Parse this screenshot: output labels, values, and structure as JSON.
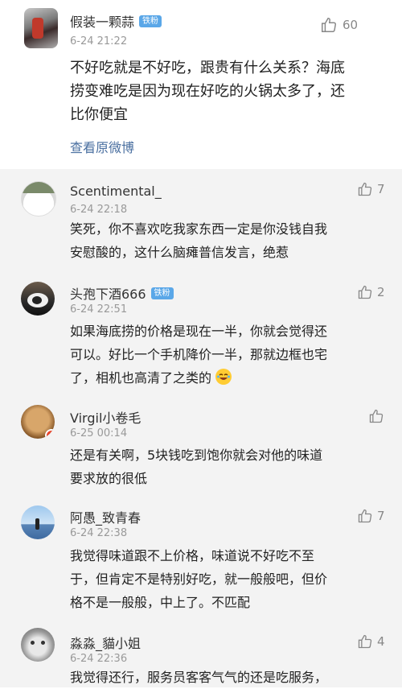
{
  "main_comment": {
    "username": "假装一颗蒜",
    "badge": "铁粉",
    "time": "6-24 21:22",
    "like_count": "60",
    "lines": [
      "不好吃就是不好吃，跟贵有什么关系？海底",
      "捞变难吃是因为现在好吃的火锅太多了，还",
      "比你便宜"
    ],
    "view_original": "查看原微博"
  },
  "replies": [
    {
      "username": "Scentimental_",
      "badge": "",
      "time": "6-24 22:18",
      "like_count": "7",
      "lines": [
        "笑死，你不喜欢吃我家东西一定是你没钱自我",
        "安慰酸的，这什么脑瘫普信发言，绝惹"
      ]
    },
    {
      "username": "头孢下酒666",
      "badge": "铁粉",
      "time": "6-24 22:51",
      "like_count": "2",
      "lines": [
        "如果海底捞的价格是现在一半，你就会觉得还",
        "可以。好比一个手机降价一半，那就边框也宅",
        "了，相机也高清了之类的"
      ]
    },
    {
      "username": "Virgil小卷毛",
      "badge": "",
      "time": "6-25 00:14",
      "like_count": "",
      "lines": [
        "还是有关啊，5块钱吃到饱你就会对他的味道",
        "要求放的很低"
      ]
    },
    {
      "username": "阿愚_致青春",
      "badge": "",
      "time": "6-24 22:38",
      "like_count": "7",
      "lines": [
        "我觉得味道跟不上价格，味道说不好吃不至",
        "于，但肯定不是特别好吃，就一般般吧，但价",
        "格不是一般般，中上了。不匹配"
      ]
    },
    {
      "username": "淼淼_貓小姐",
      "badge": "",
      "time": "6-24 22:36",
      "like_count": "4",
      "lines": [
        "我觉得还行，服务员客客气气的还是吃服务，"
      ]
    }
  ],
  "colors": {
    "link": "#4a6fa0",
    "badge": "#5aa7e8",
    "reply_bg": "#f3f3f3"
  }
}
